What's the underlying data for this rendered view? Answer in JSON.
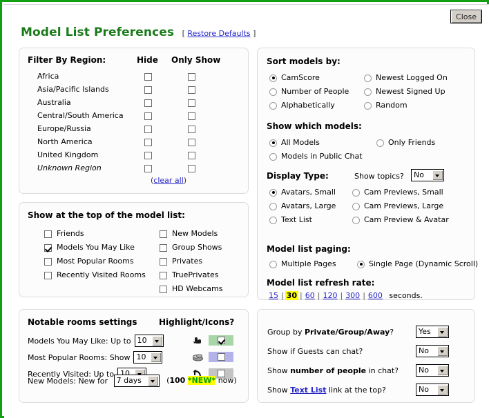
{
  "window": {
    "close_label": "Close",
    "accent_border": "#12a012",
    "title": "Model List Preferences",
    "restore_open": "[",
    "restore_label": "Restore Defaults",
    "restore_close": "]"
  },
  "region_panel": {
    "heading": "Filter By Region:",
    "col_hide": "Hide",
    "col_only_show": "Only Show",
    "clear_open": "(",
    "clear_label": "clear all",
    "clear_close": ")",
    "rows": [
      {
        "name": "Africa",
        "italic": false,
        "hide": false,
        "only_show": false
      },
      {
        "name": "Asia/Pacific Islands",
        "italic": false,
        "hide": false,
        "only_show": false
      },
      {
        "name": "Australia",
        "italic": false,
        "hide": false,
        "only_show": false
      },
      {
        "name": "Central/South America",
        "italic": false,
        "hide": false,
        "only_show": false
      },
      {
        "name": "Europe/Russia",
        "italic": false,
        "hide": false,
        "only_show": false
      },
      {
        "name": "North America",
        "italic": false,
        "hide": false,
        "only_show": false
      },
      {
        "name": "United Kingdom",
        "italic": false,
        "hide": false,
        "only_show": false
      },
      {
        "name": "Unknown Region",
        "italic": true,
        "hide": false,
        "only_show": false
      }
    ]
  },
  "top_panel": {
    "heading": "Show at the top of the model list:",
    "left_items": [
      {
        "label": "Friends",
        "checked": false
      },
      {
        "label": "Models You May Like",
        "checked": true
      },
      {
        "label": "Most Popular Rooms",
        "checked": false
      },
      {
        "label": "Recently Visited Rooms",
        "checked": false
      }
    ],
    "right_items": [
      {
        "label": "New Models",
        "checked": false
      },
      {
        "label": "Group Shows",
        "checked": false
      },
      {
        "label": "Privates",
        "checked": false
      },
      {
        "label": "TruePrivates",
        "checked": false
      },
      {
        "label": "HD Webcams",
        "checked": false
      }
    ]
  },
  "sort_panel": {
    "sort_heading": "Sort models by:",
    "sort_left": [
      {
        "label": "CamScore",
        "selected": true
      },
      {
        "label": "Number of People",
        "selected": false
      },
      {
        "label": "Alphabetically",
        "selected": false
      }
    ],
    "sort_right": [
      {
        "label": "Newest Logged On",
        "selected": false
      },
      {
        "label": "Newest Signed Up",
        "selected": false
      },
      {
        "label": "Random",
        "selected": false
      }
    ],
    "which_heading": "Show which models:",
    "which_left": [
      {
        "label": "All Models",
        "selected": true
      },
      {
        "label": "Models in Public Chat",
        "selected": false
      }
    ],
    "which_right": [
      {
        "label": "Only Friends",
        "selected": false
      }
    ],
    "display_heading": "Display Type:",
    "show_topics_label": "Show topics?",
    "show_topics_value": "No",
    "display_left": [
      {
        "label": "Avatars, Small",
        "selected": true
      },
      {
        "label": "Avatars, Large",
        "selected": false
      },
      {
        "label": "Text List",
        "selected": false
      }
    ],
    "display_right": [
      {
        "label": "Cam Previews, Small",
        "selected": false
      },
      {
        "label": "Cam Previews, Large",
        "selected": false
      },
      {
        "label": "Cam Preview & Avatar",
        "selected": false
      }
    ],
    "paging_heading": "Model list paging:",
    "paging_options": [
      {
        "label": "Multiple Pages",
        "selected": false
      },
      {
        "label": "Single Page (Dynamic Scroll)",
        "selected": true
      }
    ],
    "refresh_heading": "Model list refresh rate:",
    "refresh_options": [
      "15",
      "30",
      "60",
      "120",
      "300",
      "600"
    ],
    "refresh_current": "30",
    "refresh_suffix": "seconds.",
    "refresh_separator": "|"
  },
  "notable_panel": {
    "heading": "Notable rooms settings",
    "highlight_heading": "Highlight/Icons?",
    "rows": [
      {
        "label": "Models You May Like: Up to",
        "value": "10",
        "icon": "pointing-hand-icon",
        "swatch": "green",
        "checked": true
      },
      {
        "label": "Most Popular Rooms: Show",
        "value": "10",
        "icon": "coins-icon",
        "swatch": "lav",
        "checked": false
      },
      {
        "label": "Recently Visited: Up to",
        "value": "10",
        "icon": "back-arrow-icon",
        "swatch": "gray",
        "checked": false
      }
    ],
    "new_models_label": "New Models: New for",
    "new_models_value": "7 days",
    "new_open": "(",
    "new_count": "100",
    "new_tag": "*NEW*",
    "new_suffix": "now",
    "new_close": ")"
  },
  "group_panel": {
    "rows": [
      {
        "pre": "Group by ",
        "bold": "Private/Group/Away",
        "post": "?",
        "value": "Yes",
        "link": false
      },
      {
        "pre": "Show if Guests can chat?",
        "bold": "",
        "post": "",
        "value": "No",
        "link": false
      },
      {
        "pre": "Show ",
        "bold": "number of people",
        "post": " in chat?",
        "value": "No",
        "link": false
      },
      {
        "pre": "Show ",
        "bold": "Text List",
        "post": " link at the top?",
        "value": "No",
        "link": true
      }
    ]
  }
}
